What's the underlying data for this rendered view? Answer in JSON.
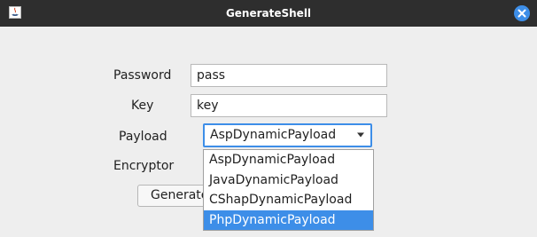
{
  "window": {
    "title": "GenerateShell",
    "app_icon": "java-icon",
    "close_icon": "close-icon"
  },
  "form": {
    "password_label": "Password",
    "password_value": "pass",
    "key_label": "Key",
    "key_value": "key",
    "payload_label": "Payload",
    "payload_selected": "AspDynamicPayload",
    "encryptor_label": "Encryptor",
    "generate_label": "Generate"
  },
  "payload_options": [
    "AspDynamicPayload",
    "JavaDynamicPayload",
    "CShapDynamicPayload",
    "PhpDynamicPayload"
  ],
  "colors": {
    "titlebar": "#2e2e2e",
    "accent": "#3d8ee8",
    "background": "#eeeeee"
  }
}
